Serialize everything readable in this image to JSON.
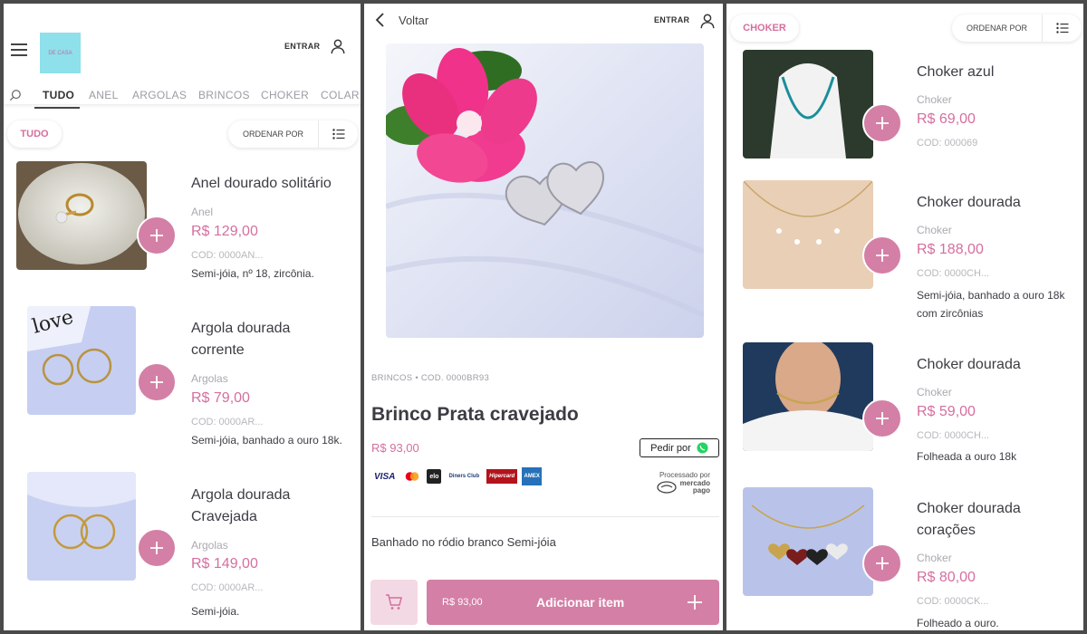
{
  "colors": {
    "accent": "#d46f9f",
    "accent_button": "#d47fa6",
    "accent_light": "#f3d9e4"
  },
  "header": {
    "login_label": "ENTRAR",
    "logo_text": "DE CASA"
  },
  "tabs": [
    "TUDO",
    "ANEL",
    "ARGOLAS",
    "BRINCOS",
    "CHOKER",
    "COLAR"
  ],
  "list_left": {
    "filter_chip": "TUDO",
    "sort_label": "ORDENAR POR",
    "items": [
      {
        "name": "Anel dourado solitário",
        "category": "Anel",
        "price": "R$ 129,00",
        "code": "COD: 0000AN...",
        "desc": "Semi-jóia, nº 18, zircônia."
      },
      {
        "name": "Argola dourada corrente",
        "category": "Argolas",
        "price": "R$ 79,00",
        "code": "COD: 0000AR...",
        "desc": "Semi-jóia, banhado a ouro 18k."
      },
      {
        "name": "Argola dourada Cravejada",
        "category": "Argolas",
        "price": "R$ 149,00",
        "code": "COD: 0000AR...",
        "desc": "Semi-jóia."
      }
    ]
  },
  "detail": {
    "back_label": "Voltar",
    "login_label": "ENTRAR",
    "breadcrumb": "BRINCOS • COD. 0000BR93",
    "title": "Brinco Prata cravejado",
    "price": "R$ 93,00",
    "order_via": "Pedir por",
    "payment_methods": [
      "VISA",
      "Mastercard",
      "elo",
      "Diners Club",
      "Hipercard",
      "AMEX"
    ],
    "processed_by": "Processado por",
    "processor": "mercado pago",
    "description": "Banhado no ródio branco Semi-jóia",
    "add_button_price": "R$ 93,00",
    "add_button_label": "Adicionar item"
  },
  "list_right": {
    "filter_chip": "CHOKER",
    "sort_label": "ORDENAR POR",
    "items": [
      {
        "name": "Choker azul",
        "category": "Choker",
        "price": "R$ 69,00",
        "code": "COD: 000069",
        "desc": ""
      },
      {
        "name": "Choker dourada",
        "category": "Choker",
        "price": "R$ 188,00",
        "code": "COD: 0000CH...",
        "desc": "Semi-jóia, banhado a ouro 18k com zircônias"
      },
      {
        "name": "Choker dourada",
        "category": "Choker",
        "price": "R$ 59,00",
        "code": "COD: 0000CH...",
        "desc": "Folheada a ouro 18k"
      },
      {
        "name": "Choker dourada corações",
        "category": "Choker",
        "price": "R$ 80,00",
        "code": "COD: 0000CK...",
        "desc": "Folheado a ouro."
      }
    ]
  }
}
